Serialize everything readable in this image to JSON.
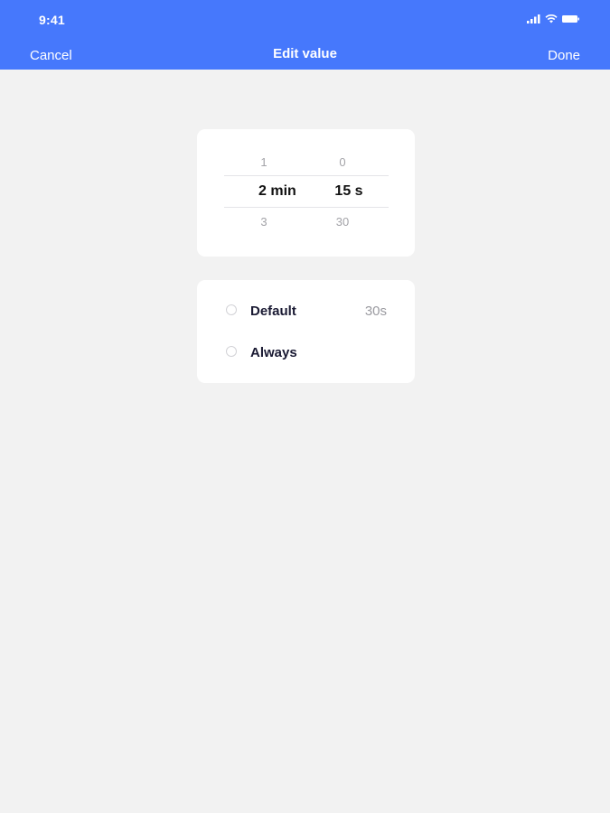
{
  "status_bar": {
    "time": "9:41"
  },
  "nav": {
    "cancel_label": "Cancel",
    "title": "Edit value",
    "done_label": "Done"
  },
  "picker": {
    "minutes": {
      "above": "1",
      "selected": "2 min",
      "below": "3"
    },
    "seconds": {
      "above": "0",
      "selected": "15 s",
      "below": "30"
    }
  },
  "options": [
    {
      "label": "Default",
      "value": "30s",
      "selected": false
    },
    {
      "label": "Always",
      "value": "",
      "selected": false
    }
  ],
  "colors": {
    "accent": "#4678fc",
    "background": "#f2f2f2",
    "card": "#ffffff"
  }
}
